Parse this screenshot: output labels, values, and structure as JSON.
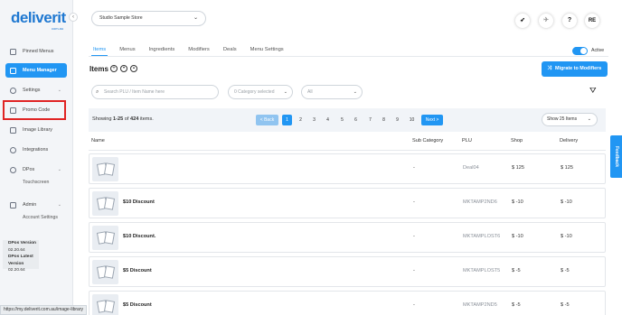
{
  "brand": {
    "logo": "deliverit",
    "sub": "com.au"
  },
  "sidebar": {
    "items": [
      {
        "label": "Pinned Menus"
      },
      {
        "label": "Menu Manager"
      },
      {
        "label": "Settings"
      },
      {
        "label": "Promo Code"
      },
      {
        "label": "Image Library"
      },
      {
        "label": "Integrations"
      },
      {
        "label": "DPos"
      },
      {
        "label": "Touchscreen"
      },
      {
        "label": "Admin"
      },
      {
        "label": "Account Settings"
      }
    ],
    "version_label": "DPos Version",
    "version_value": "02.20.64",
    "latest_label": "DPos Latest Version",
    "latest_value": "02.20.64"
  },
  "header": {
    "store": "Studio Sample Store",
    "avatar": "RE",
    "help": "?"
  },
  "tabs": [
    "Items",
    "Menus",
    "Ingredients",
    "Modifiers",
    "Deals",
    "Menu Settings"
  ],
  "active_toggle_label": "Active",
  "items_title": "Items",
  "migrate_button": "Migrate to Modifiers",
  "filters": {
    "search_placeholder": "Search PLU / Item Name here",
    "category": "0 Category selected",
    "all": "All"
  },
  "pagination": {
    "showing_prefix": "Showing ",
    "range": "1-25",
    "of": " of ",
    "total": "424",
    "suffix": " items.",
    "back": "< Back",
    "pages": [
      "1",
      "2",
      "3",
      "4",
      "5",
      "6",
      "7",
      "8",
      "9",
      "10"
    ],
    "next": "Next >",
    "show": "Show 25 Items"
  },
  "table": {
    "headers": {
      "name": "Name",
      "sub_category": "Sub Category",
      "plu": "PLU",
      "shop": "Shop",
      "delivery": "Delivery"
    },
    "rows": [
      {
        "name": "",
        "sub": "-",
        "plu": "Deal04",
        "shop": "$ 125",
        "delivery": "$ 125"
      },
      {
        "name": "$10 Discount",
        "sub": "-",
        "plu": "MKTAMP2ND6",
        "shop": "$ -10",
        "delivery": "$ -10"
      },
      {
        "name": "$10 Discount.",
        "sub": "-",
        "plu": "MKTAMPLOST6",
        "shop": "$ -10",
        "delivery": "$ -10"
      },
      {
        "name": "$5 Discount",
        "sub": "-",
        "plu": "MKTAMPLOST5",
        "shop": "$ -5",
        "delivery": "$ -5"
      },
      {
        "name": "$5 Discount",
        "sub": "-",
        "plu": "MKTAMP2ND5",
        "shop": "$ -5",
        "delivery": "$ -5"
      }
    ]
  },
  "feedback": "Feedback",
  "status_url": "https://my.deliverit.com.au/image-library"
}
